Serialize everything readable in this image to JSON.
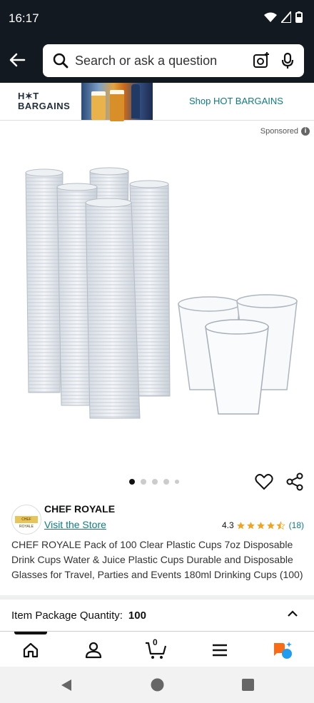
{
  "status_bar": {
    "time": "16:17"
  },
  "search": {
    "placeholder": "Search or ask a question"
  },
  "banner": {
    "logo_line1": "H✶T",
    "logo_line2": "BARGAINS",
    "link": "Shop HOT BARGAINS"
  },
  "sponsored": {
    "label": "Sponsored"
  },
  "gallery": {
    "image_count": 5,
    "active_index": 0
  },
  "brand": {
    "name": "CHEF ROYALE",
    "store_link": "Visit the Store",
    "logo_text": "CHEF ROYALE"
  },
  "rating": {
    "value": "4.3",
    "stars": 4.3,
    "count": "(18)"
  },
  "product": {
    "title": "CHEF ROYALE Pack of 100 Clear Plastic Cups 7oz Disposable Drink Cups Water & Juice Plastic Cups Durable and Disposable Glasses for Travel, Parties and Events 180ml Drinking Cups (100)"
  },
  "quantity": {
    "label": "Item Package Quantity:",
    "value": "100"
  },
  "bottom_nav": {
    "cart_count": "0"
  },
  "colors": {
    "header": "#131921",
    "link": "#0F7B84",
    "star": "#F4A21D",
    "nav_indicator": "#111111",
    "rufus_orange": "#F96B16",
    "rufus_blue": "#1F9BF0"
  }
}
